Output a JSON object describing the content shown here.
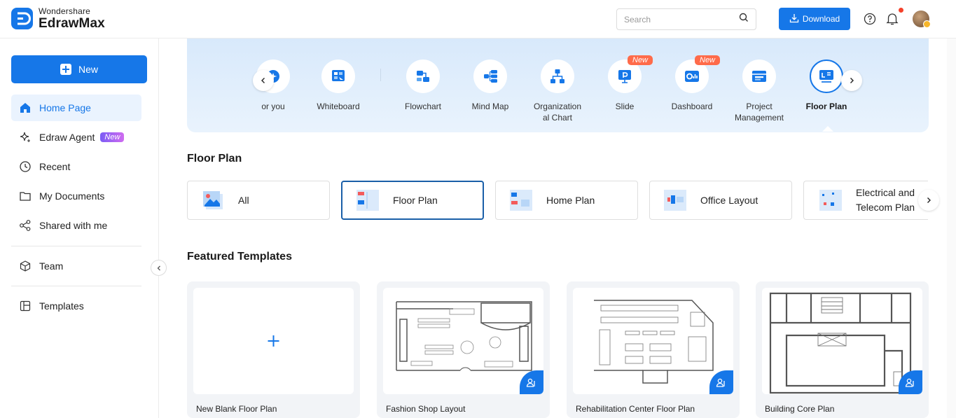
{
  "header": {
    "brand_small": "Wondershare",
    "brand_big": "EdrawMax",
    "search_placeholder": "Search",
    "download_label": "Download"
  },
  "sidebar": {
    "new_label": "New",
    "items": [
      {
        "label": "Home Page"
      },
      {
        "label": "Edraw Agent",
        "badge": "New"
      },
      {
        "label": "Recent"
      },
      {
        "label": "My Documents"
      },
      {
        "label": "Shared with me"
      },
      {
        "label": "Team"
      },
      {
        "label": "Templates"
      }
    ]
  },
  "categories": [
    {
      "label": "or you"
    },
    {
      "label": "Whiteboard"
    },
    {
      "label": "Flowchart"
    },
    {
      "label": "Mind Map"
    },
    {
      "label": "Organization al Chart"
    },
    {
      "label": "Slide",
      "tag": "New"
    },
    {
      "label": "Dashboard",
      "tag": "New"
    },
    {
      "label": "Project Management"
    },
    {
      "label": "Floor Plan"
    }
  ],
  "floor_plan_section": {
    "title": "Floor Plan",
    "subcategories": [
      {
        "label": "All"
      },
      {
        "label": "Floor Plan"
      },
      {
        "label": "Home Plan"
      },
      {
        "label": "Office Layout"
      },
      {
        "label": "Electrical and Telecom Plan"
      }
    ]
  },
  "featured": {
    "title": "Featured Templates",
    "templates": [
      {
        "label": "New Blank Floor Plan"
      },
      {
        "label": "Fashion Shop Layout"
      },
      {
        "label": "Rehabilitation Center Floor Plan"
      },
      {
        "label": "Building Core Plan"
      }
    ]
  },
  "colors": {
    "accent": "#1677e8",
    "new_tag": "#ff6b4a"
  }
}
